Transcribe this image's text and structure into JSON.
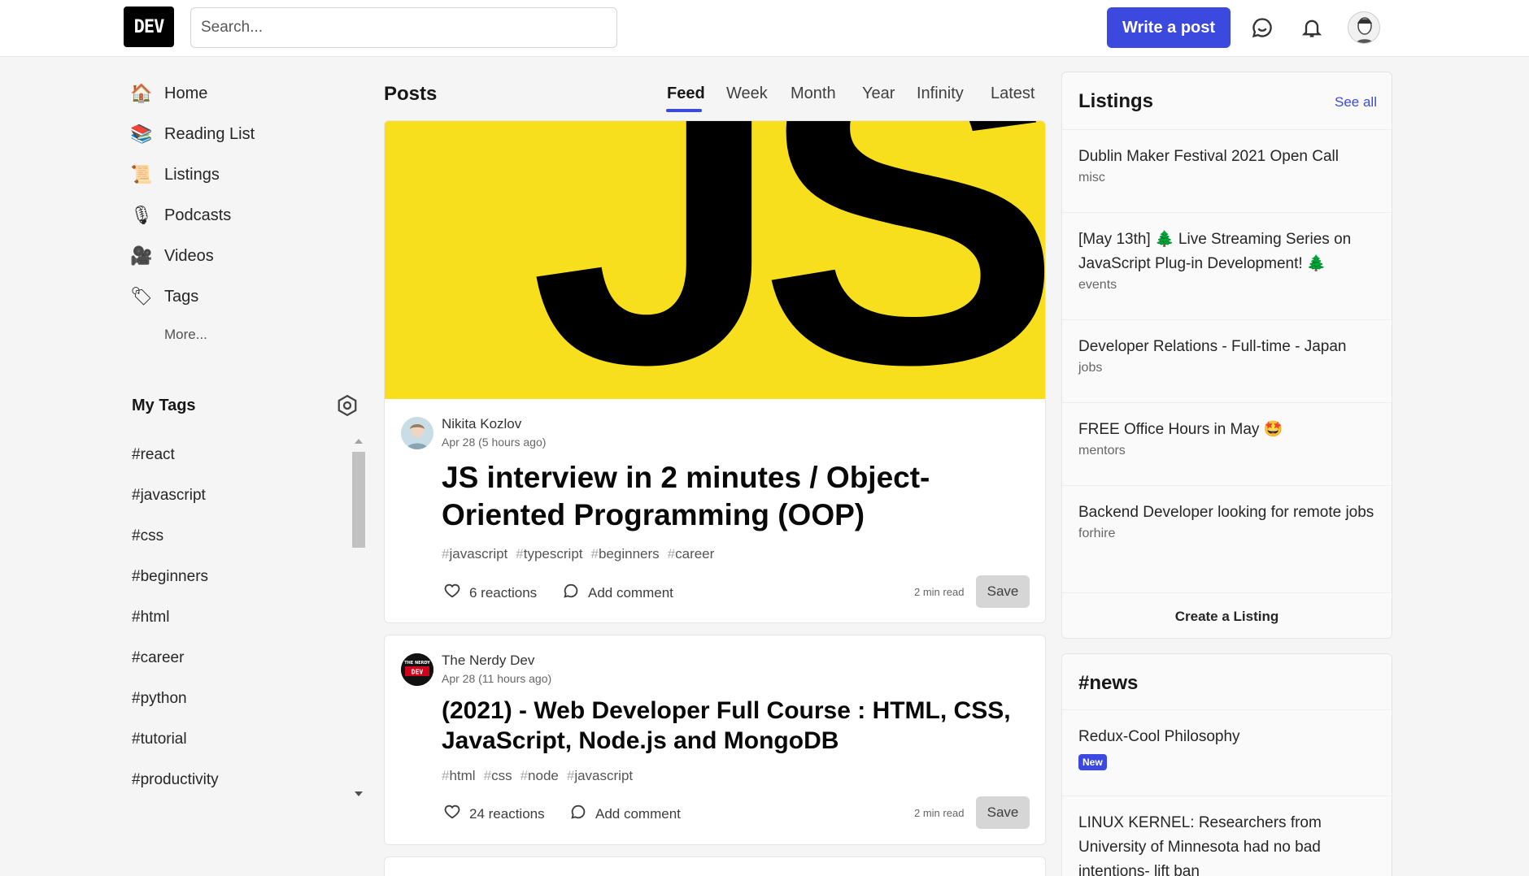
{
  "header": {
    "logo": "DEV",
    "search_placeholder": "Search...",
    "write_post": "Write a post"
  },
  "sidebar": {
    "items": [
      {
        "label": "Home",
        "icon": "🏠"
      },
      {
        "label": "Reading List",
        "icon": "📚"
      },
      {
        "label": "Listings",
        "icon": "📜"
      },
      {
        "label": "Podcasts",
        "icon": "🎙"
      },
      {
        "label": "Videos",
        "icon": "🎥"
      },
      {
        "label": "Tags",
        "icon": "🏷"
      }
    ],
    "more": "More...",
    "my_tags_title": "My Tags",
    "tags": [
      "#react",
      "#javascript",
      "#css",
      "#beginners",
      "#html",
      "#career",
      "#python",
      "#tutorial",
      "#productivity"
    ]
  },
  "posts": {
    "title": "Posts",
    "tabs": [
      "Feed",
      "Week",
      "Month",
      "Year",
      "Infinity",
      "Latest"
    ],
    "active_tab": "Feed",
    "cover_text": "JS",
    "items": [
      {
        "author": "Nikita Kozlov",
        "date": "Apr 28 (5 hours ago)",
        "title": "JS interview in 2 minutes / Object-Oriented Programming (OOP)",
        "tags": [
          "javascript",
          "typescript",
          "beginners",
          "career"
        ],
        "reactions": "6 reactions",
        "comment": "Add comment",
        "read_time": "2 min read",
        "save": "Save"
      },
      {
        "author": "The Nerdy Dev",
        "date": "Apr 28 (11 hours ago)",
        "title": "(2021) - Web Developer Full Course : HTML, CSS, JavaScript, Node.js and MongoDB",
        "tags": [
          "html",
          "css",
          "node",
          "javascript"
        ],
        "reactions": "24 reactions",
        "comment": "Add comment",
        "read_time": "2 min read",
        "save": "Save",
        "avatar_text": "DEV"
      }
    ]
  },
  "listings": {
    "title": "Listings",
    "see_all": "See all",
    "items": [
      {
        "title": "Dublin Maker Festival 2021 Open Call",
        "category": "misc"
      },
      {
        "title": "[May 13th] 🌲 Live Streaming Series on JavaScript Plug-in Development! 🌲",
        "category": "events"
      },
      {
        "title": "Developer Relations - Full-time - Japan",
        "category": "jobs"
      },
      {
        "title": "FREE Office Hours in May 🤩",
        "category": "mentors"
      },
      {
        "title": "Backend Developer looking for remote jobs",
        "category": "forhire"
      }
    ],
    "create": "Create a Listing"
  },
  "news": {
    "title": "#news",
    "items": [
      {
        "title": "Redux-Cool Philosophy",
        "badge": "New"
      },
      {
        "title": "LINUX KERNEL: Researchers from University of Minnesota had no bad intentions- lift ban"
      }
    ]
  },
  "colors": {
    "accent": "#3b49df",
    "js_yellow": "#f7df1e",
    "background": "#f5f5f5"
  }
}
